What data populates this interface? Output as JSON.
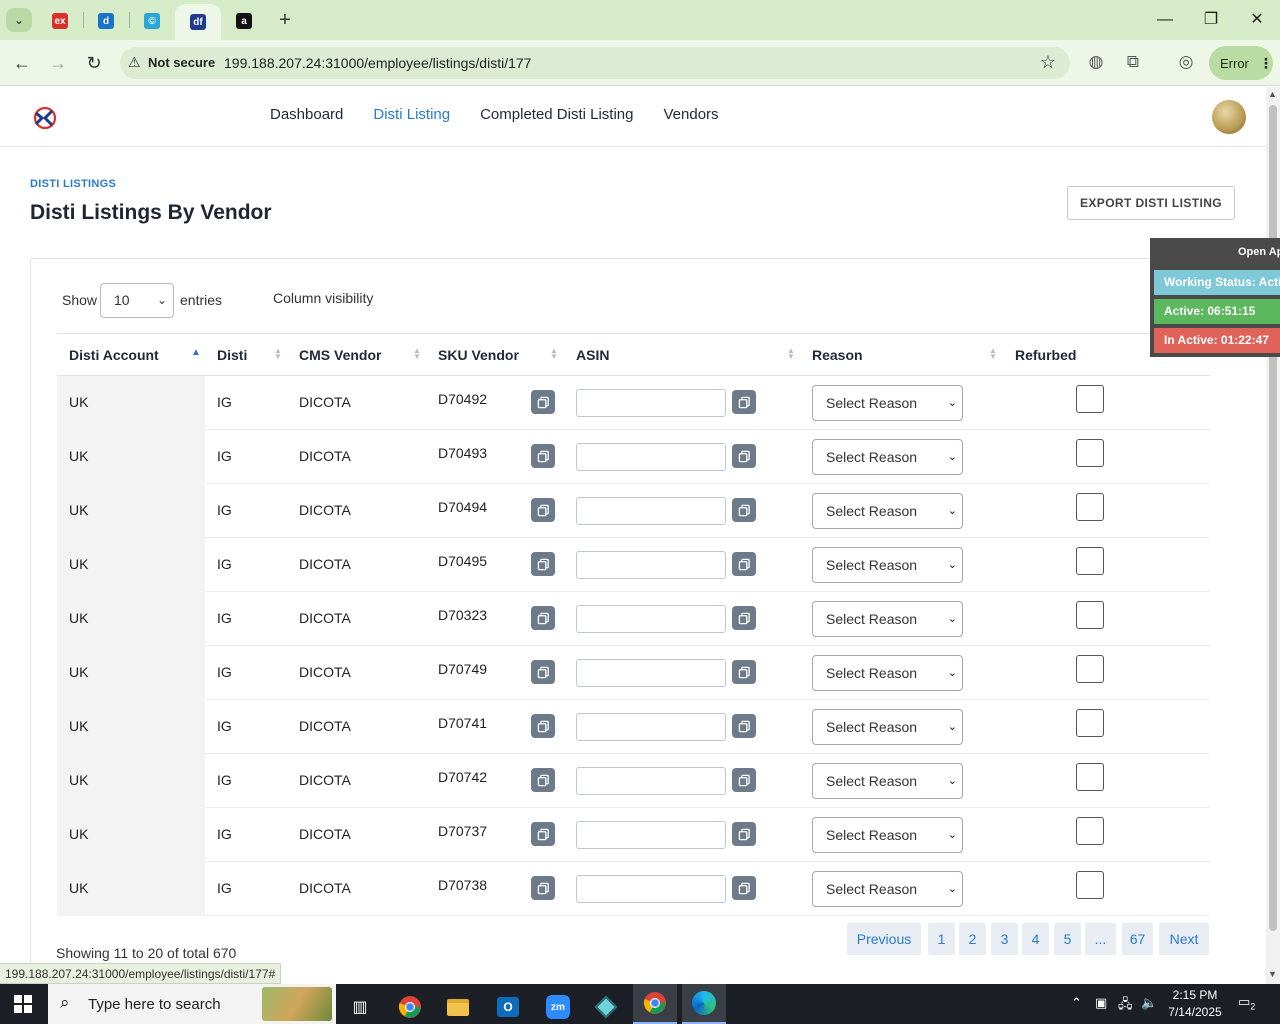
{
  "browser": {
    "tabs": [
      {
        "icon": "ex-favicon",
        "text": "ex",
        "color": "#d9302c"
      },
      {
        "icon": "d-favicon",
        "text": "d",
        "color": "#1a73c8"
      },
      {
        "icon": "c-favicon",
        "text": "©",
        "color": "#2aa7d8"
      },
      {
        "icon": "df-favicon",
        "text": "df",
        "color": "#1f3b8a"
      },
      {
        "icon": "amazon-favicon",
        "text": "a",
        "color": "#111111"
      }
    ],
    "security_label": "Not secure",
    "url": "199.188.207.24:31000/employee/listings/disti/177",
    "error_label": "Error",
    "status_url": "199.188.207.24:31000/employee/listings/disti/177#"
  },
  "nav": {
    "links": [
      "Dashboard",
      "Disti Listing",
      "Completed Disti Listing",
      "Vendors"
    ],
    "active_index": 1
  },
  "header": {
    "breadcrumb": "DISTI LISTINGS",
    "title": "Disti Listings By Vendor",
    "export_label": "EXPORT DISTI LISTING"
  },
  "controls": {
    "show_label": "Show",
    "page_size": "10",
    "entries_label": "entries",
    "column_visibility": "Column visibility"
  },
  "table": {
    "columns": [
      "Disti Account",
      "Disti",
      "CMS Vendor",
      "SKU Vendor",
      "ASIN",
      "Reason",
      "Refurbed"
    ],
    "reason_placeholder": "Select Reason",
    "rows": [
      {
        "account": "UK",
        "disti": "IG",
        "vendor": "DICOTA",
        "sku": "D70492"
      },
      {
        "account": "UK",
        "disti": "IG",
        "vendor": "DICOTA",
        "sku": "D70493"
      },
      {
        "account": "UK",
        "disti": "IG",
        "vendor": "DICOTA",
        "sku": "D70494"
      },
      {
        "account": "UK",
        "disti": "IG",
        "vendor": "DICOTA",
        "sku": "D70495"
      },
      {
        "account": "UK",
        "disti": "IG",
        "vendor": "DICOTA",
        "sku": "D70323"
      },
      {
        "account": "UK",
        "disti": "IG",
        "vendor": "DICOTA",
        "sku": "D70749"
      },
      {
        "account": "UK",
        "disti": "IG",
        "vendor": "DICOTA",
        "sku": "D70741"
      },
      {
        "account": "UK",
        "disti": "IG",
        "vendor": "DICOTA",
        "sku": "D70742"
      },
      {
        "account": "UK",
        "disti": "IG",
        "vendor": "DICOTA",
        "sku": "D70737"
      },
      {
        "account": "UK",
        "disti": "IG",
        "vendor": "DICOTA",
        "sku": "D70738"
      }
    ]
  },
  "footer": {
    "showing": "Showing 11 to 20 of total 670",
    "pagination": [
      "Previous",
      "1",
      "2",
      "3",
      "4",
      "5",
      "...",
      "67",
      "Next"
    ]
  },
  "widget": {
    "open_label": "Open Ap",
    "working_status": "Working Status: Active",
    "active_time": "Active: 06:51:15",
    "inactive_time": "In Active: 01:22:47",
    "colors": {
      "working": "#7ec8d8",
      "active": "#5cb85c",
      "inactive": "#e0635a"
    }
  },
  "taskbar": {
    "search_placeholder": "Type here to search",
    "time": "2:15 PM",
    "date": "7/14/2025",
    "notification_count": "2"
  }
}
